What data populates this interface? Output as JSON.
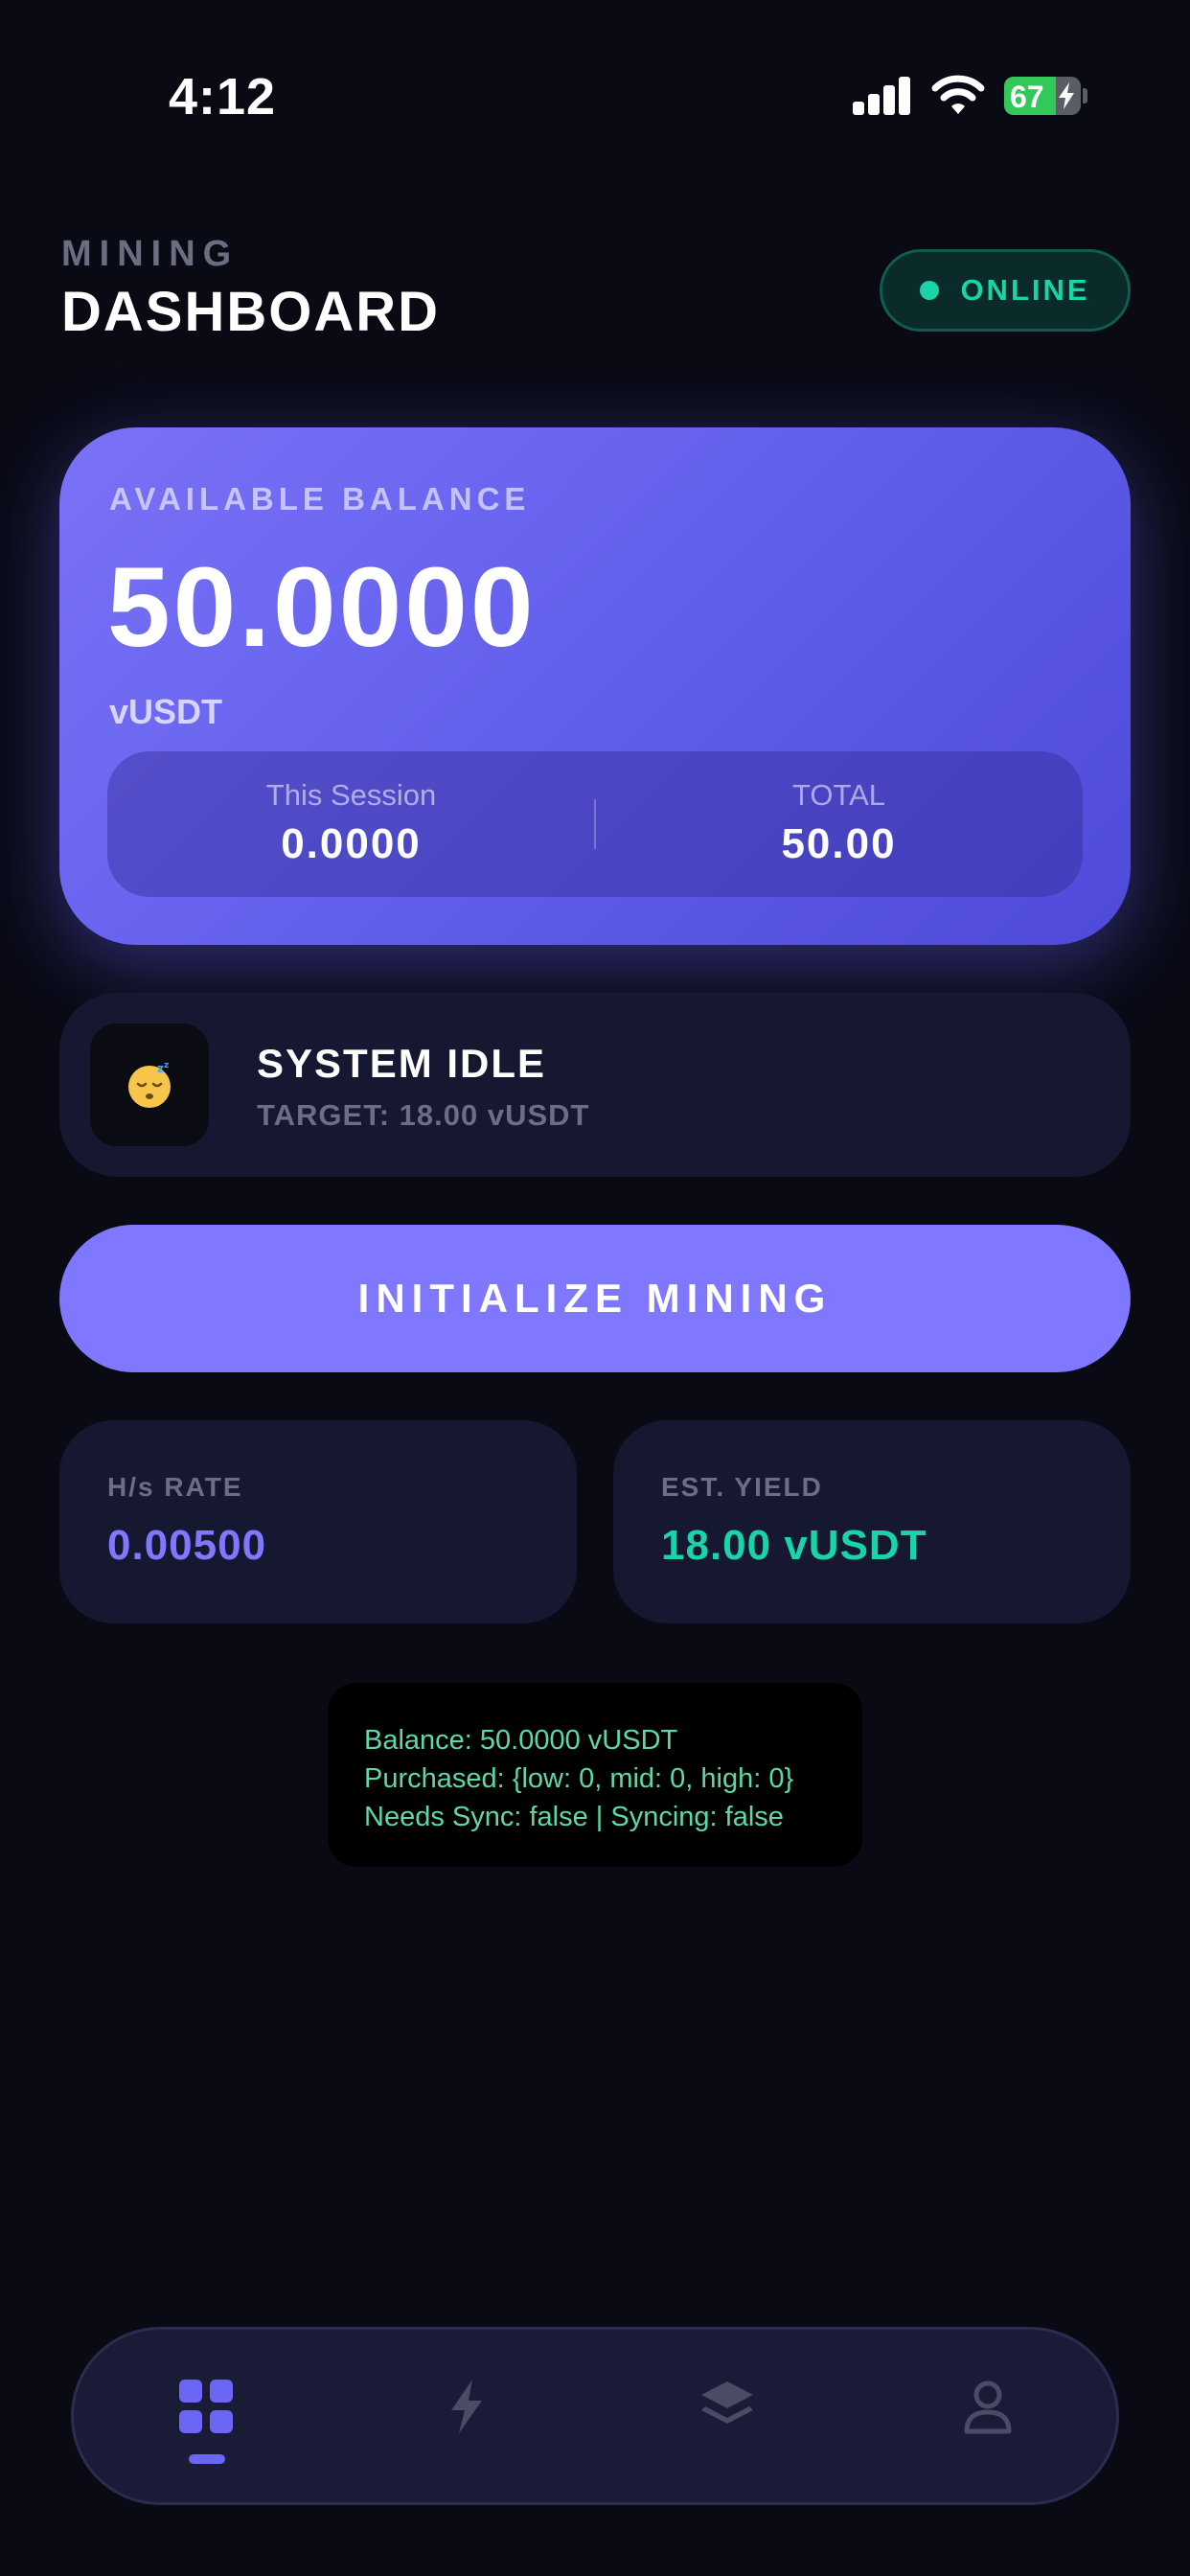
{
  "status_bar": {
    "time": "4:12",
    "battery_percent": "67",
    "battery_level": 0.67,
    "icons": [
      "signal-icon",
      "wifi-icon",
      "battery-charging-icon"
    ]
  },
  "header": {
    "subtitle": "MINING",
    "title": "DASHBOARD",
    "status_label": "ONLINE"
  },
  "balance": {
    "label": "AVAILABLE BALANCE",
    "amount": "50.0000",
    "unit": "vUSDT",
    "session_label": "This Session",
    "session_value": "0.0000",
    "total_label": "TOTAL",
    "total_value": "50.00"
  },
  "system": {
    "icon": "sleeping-face-emoji",
    "emoji": "😴",
    "title": "SYSTEM IDLE",
    "target": "TARGET: 18.00 vUSDT"
  },
  "actions": {
    "init_label": "INITIALIZE MINING"
  },
  "stats": {
    "rate_label": "H/s RATE",
    "rate_value": "0.00500",
    "yield_label": "EST. YIELD",
    "yield_value": "18.00 vUSDT"
  },
  "debug": {
    "lines": [
      "Balance: 50.0000 vUSDT",
      "Purchased: {low: 0, mid: 0, high: 0}",
      "Needs Sync: false | Syncing: false"
    ]
  },
  "nav": {
    "items": [
      {
        "icon": "grid-icon",
        "active": true
      },
      {
        "icon": "lightning-icon",
        "active": false
      },
      {
        "icon": "layers-icon",
        "active": false
      },
      {
        "icon": "user-icon",
        "active": false
      }
    ]
  },
  "colors": {
    "background": "#090a14",
    "accent": "#7f78ff",
    "online": "#19d4a8",
    "rate": "#7f78ff",
    "yield": "#19d4a8",
    "debug_text": "#5ed8a4",
    "nav_active": "#6b66f4",
    "nav_inactive": "#4a4c66"
  }
}
